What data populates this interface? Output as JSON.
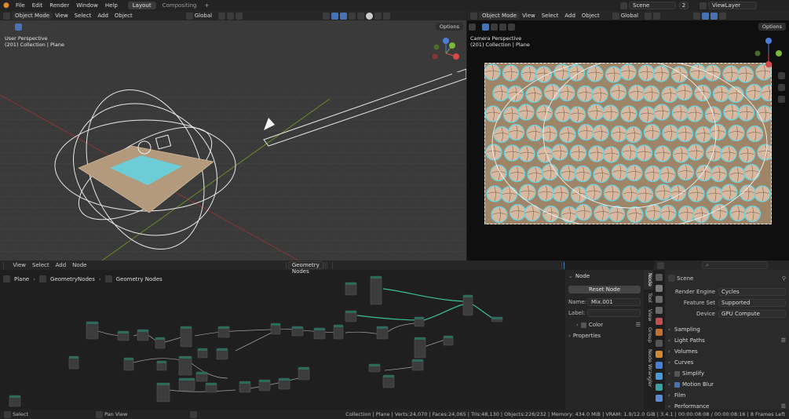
{
  "topbar": {
    "menus": [
      "File",
      "Edit",
      "Render",
      "Window",
      "Help"
    ],
    "tabs": [
      "Layout",
      "Compositing"
    ],
    "scene": "Scene",
    "scene_count": "2",
    "view_layer": "ViewLayer"
  },
  "viewport_left": {
    "mode": "Object Mode",
    "menus": [
      "View",
      "Select",
      "Add",
      "Object"
    ],
    "transform": "Global",
    "options": "Options",
    "overlay_line1": "User Perspective",
    "overlay_line2": "(201) Collection | Plane"
  },
  "viewport_right": {
    "mode": "Object Mode",
    "menus": [
      "View",
      "Select",
      "Add",
      "Object"
    ],
    "transform": "Global",
    "options": "Options",
    "overlay_line1": "Camera Perspective",
    "overlay_line2": "(201) Collection | Plane"
  },
  "node_editor": {
    "menus": [
      "View",
      "Select",
      "Add",
      "Node"
    ],
    "tree_name": "Geometry Nodes",
    "breadcrumb": [
      "Plane",
      "GeometryNodes",
      "Geometry Nodes"
    ]
  },
  "npanel": {
    "title": "Node",
    "reset": "Reset Node",
    "name_label": "Name:",
    "name_value": "Mix.001",
    "label_label": "Label:",
    "label_value": "",
    "color": "Color",
    "properties": "Properties",
    "tabs": [
      "Node",
      "Tool",
      "View",
      "Group",
      "Node Wrangler"
    ]
  },
  "properties": {
    "scene": "Scene",
    "rows": [
      {
        "k": "Render Engine",
        "v": "Cycles"
      },
      {
        "k": "Feature Set",
        "v": "Supported"
      },
      {
        "k": "Device",
        "v": "GPU Compute"
      }
    ],
    "sections": [
      "Sampling",
      "Light Paths",
      "Volumes",
      "Curves",
      "Simplify",
      "Motion Blur",
      "Film",
      "Performance"
    ]
  },
  "status": {
    "select": "Select",
    "pan": "Pan View",
    "stats": "Collection | Plane | Verts:24,070 | Faces:24,065 | Tris:48,130 | Objects:226/232 | Memory: 434.0 MiB | VRAM: 1.9/12.0 GiB | 3.4.1 | 00:00:08:08 / 00:00:08:16 | 8 Frames Left"
  },
  "colors": {
    "accent": "#4772b3",
    "link_green": "#3bbf9a",
    "selection_cyan": "#5fd6e6",
    "plane_tan": "#b49a7d"
  }
}
